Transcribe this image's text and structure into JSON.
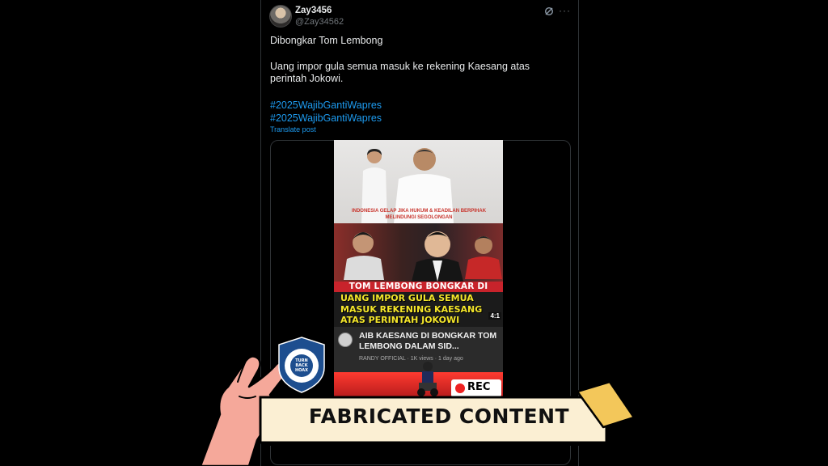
{
  "tweet": {
    "display_name": "Zay3456",
    "handle": "@Zay34562",
    "line1": "Dibongkar Tom Lembong",
    "line2": "Uang impor gula semua masuk ke rekening Kaesang atas perintah Jokowi.",
    "hashtags": [
      "#2025WajibGantiWapres",
      "#2025WajibGantiWapres"
    ],
    "translate_label": "Translate post",
    "icons": [
      "grok-icon",
      "more-icon"
    ]
  },
  "thumbnail": {
    "small_caption": "INDONESIA GELAP JIKA HUKUM & KEADILAN BERPIHAK MELINDUNGI SEGOLONGAN",
    "red_banner": "TOM LEMBONG BONGKAR DI SIDANG",
    "yellow_lines": [
      "UANG IMPOR GULA SEMUA",
      "MASUK REKENING KAESANG",
      "ATAS PERINTAH JOKOWI"
    ],
    "duration": "4:1",
    "video_title": "AIB KAESANG DI BONGKAR TOM LEMBONG DALAM SID...",
    "video_meta": "RANDY OFFICIAL · 1K views · 1 day ago",
    "rec_label": "REC"
  },
  "overlay": {
    "badge_text": "TURN BACK HOAX",
    "badge_ring": "MASYARAKAT ANTI FITNAH INDONESIA · MAFINDO",
    "label": "FABRICATED CONTENT",
    "colors": {
      "label_bg": "#fbefd3",
      "tape": "#f3c75a",
      "hand": "#f5a89a",
      "badge": "#1d4e8f"
    }
  }
}
